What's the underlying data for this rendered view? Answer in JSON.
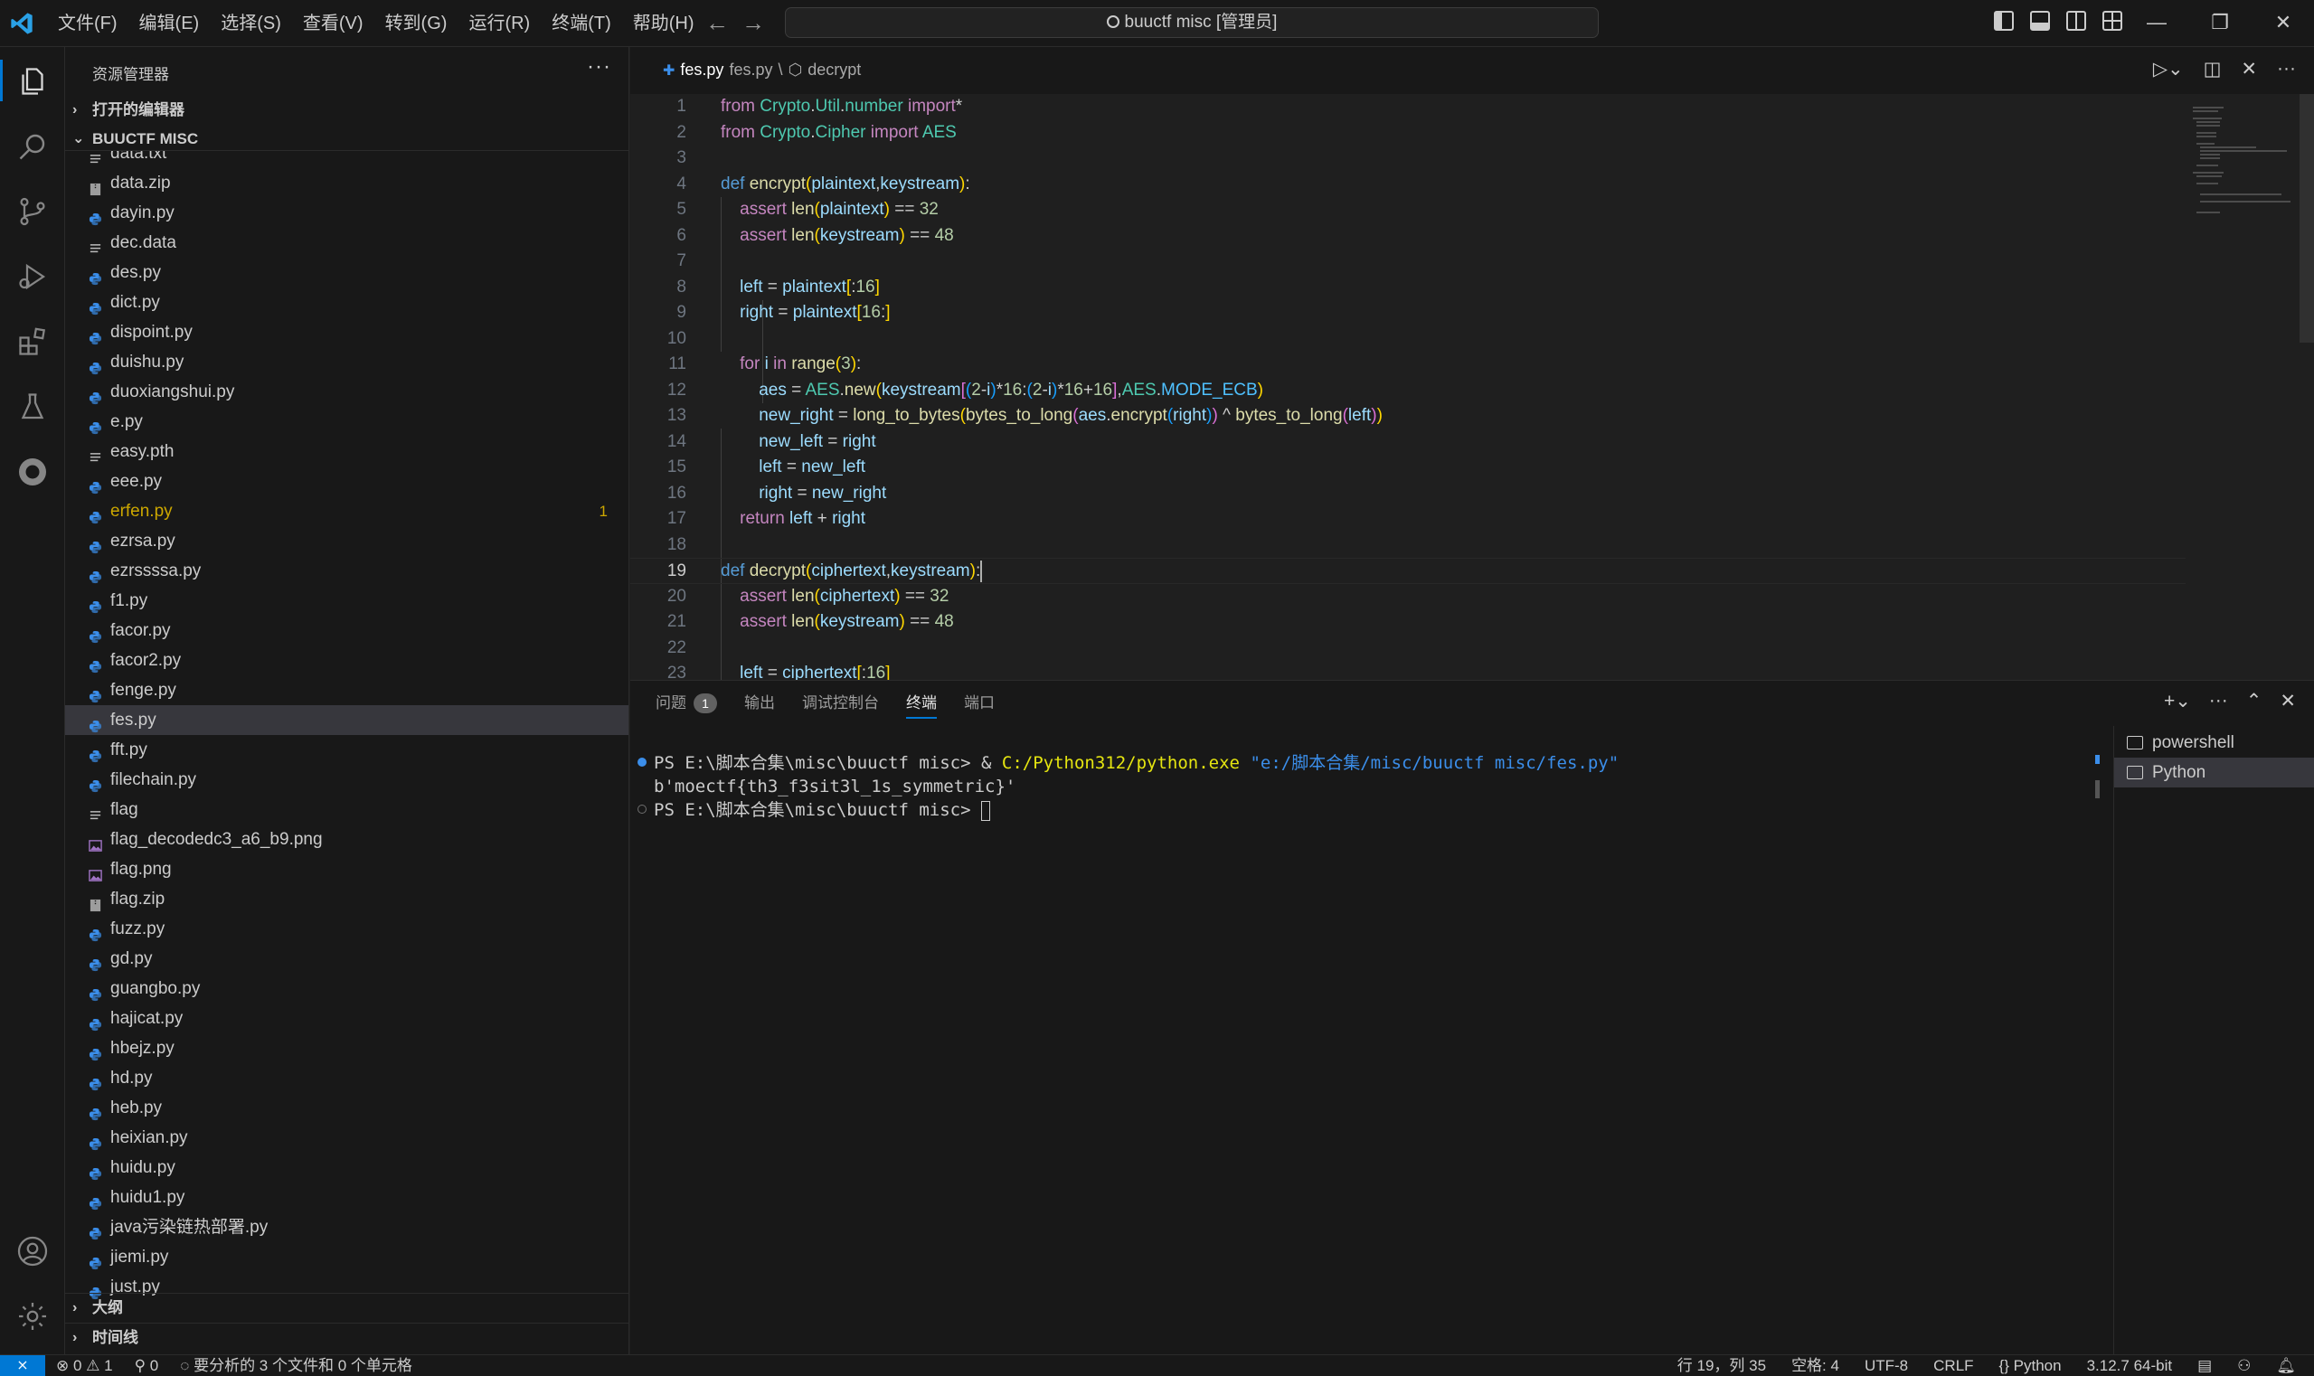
{
  "titlebar": {
    "menus": [
      "文件(F)",
      "编辑(E)",
      "选择(S)",
      "查看(V)",
      "转到(G)",
      "运行(R)",
      "终端(T)",
      "帮助(H)"
    ],
    "command_center": "buuctf misc [管理员]",
    "nav_back": "←",
    "nav_forward": "→",
    "win_minimize": "—",
    "win_restore": "❐",
    "win_close": "✕"
  },
  "sidebar": {
    "title": "资源管理器",
    "more": "···",
    "open_editors": "打开的编辑器",
    "folder": "BUUCTF MISC",
    "outline": "大纲",
    "timeline": "时间线",
    "files": [
      {
        "name": "data.txt",
        "type": "text"
      },
      {
        "name": "data.zip",
        "type": "zip"
      },
      {
        "name": "dayin.py",
        "type": "py"
      },
      {
        "name": "dec.data",
        "type": "text"
      },
      {
        "name": "des.py",
        "type": "py"
      },
      {
        "name": "dict.py",
        "type": "py"
      },
      {
        "name": "dispoint.py",
        "type": "py"
      },
      {
        "name": "duishu.py",
        "type": "py"
      },
      {
        "name": "duoxiangshui.py",
        "type": "py"
      },
      {
        "name": "e.py",
        "type": "py"
      },
      {
        "name": "easy.pth",
        "type": "text"
      },
      {
        "name": "eee.py",
        "type": "py"
      },
      {
        "name": "erfen.py",
        "type": "py",
        "badge": "1"
      },
      {
        "name": "ezrsa.py",
        "type": "py"
      },
      {
        "name": "ezrssssa.py",
        "type": "py"
      },
      {
        "name": "f1.py",
        "type": "py"
      },
      {
        "name": "facor.py",
        "type": "py"
      },
      {
        "name": "facor2.py",
        "type": "py"
      },
      {
        "name": "fenge.py",
        "type": "py"
      },
      {
        "name": "fes.py",
        "type": "py",
        "selected": true
      },
      {
        "name": "fft.py",
        "type": "py"
      },
      {
        "name": "filechain.py",
        "type": "py"
      },
      {
        "name": "flag",
        "type": "text"
      },
      {
        "name": "flag_decodedc3_a6_b9.png",
        "type": "img"
      },
      {
        "name": "flag.png",
        "type": "img"
      },
      {
        "name": "flag.zip",
        "type": "zip"
      },
      {
        "name": "fuzz.py",
        "type": "py"
      },
      {
        "name": "gd.py",
        "type": "py"
      },
      {
        "name": "guangbo.py",
        "type": "py"
      },
      {
        "name": "hajicat.py",
        "type": "py"
      },
      {
        "name": "hbejz.py",
        "type": "py"
      },
      {
        "name": "hd.py",
        "type": "py"
      },
      {
        "name": "heb.py",
        "type": "py"
      },
      {
        "name": "heixian.py",
        "type": "py"
      },
      {
        "name": "huidu.py",
        "type": "py"
      },
      {
        "name": "huidu1.py",
        "type": "py"
      },
      {
        "name": "java污染链热部署.py",
        "type": "py"
      },
      {
        "name": "jiemi.py",
        "type": "py"
      },
      {
        "name": "just.py",
        "type": "py"
      }
    ]
  },
  "editor": {
    "filename": "fes.py",
    "breadcrumb_path": "fes.py",
    "breadcrumb_symbol": "decrypt",
    "current_line": 19,
    "lines": [
      "1",
      "2",
      "3",
      "4",
      "5",
      "6",
      "7",
      "8",
      "9",
      "10",
      "11",
      "12",
      "13",
      "14",
      "15",
      "16",
      "17",
      "18",
      "19",
      "20",
      "21",
      "22",
      "23"
    ]
  },
  "panel": {
    "tabs": [
      "问题",
      "输出",
      "调试控制台",
      "终端",
      "端口"
    ],
    "problems_count": "1",
    "terminal_prompt1": "PS E:\\脚本合集\\misc\\buuctf misc> ",
    "terminal_cmd_amp": "& ",
    "terminal_cmd_exe": "C:/Python312/python.exe",
    "terminal_cmd_arg": "\"e:/脚本合集/misc/buuctf misc/fes.py\"",
    "terminal_output": "b'moectf{th3_f3sit3l_1s_symmetric}'",
    "terminal_prompt2": "PS E:\\脚本合集\\misc\\buuctf misc> ",
    "terminals": [
      "powershell",
      "Python"
    ]
  },
  "statusbar": {
    "remote": "⨯",
    "errors": "0",
    "warnings": "1",
    "ports": "0",
    "analyzing": "要分析的 3 个文件和 0 个单元格",
    "position": "行 19，列 35",
    "spaces": "空格: 4",
    "encoding": "UTF-8",
    "eol": "CRLF",
    "language": "Python",
    "interpreter": "3.12.7 64-bit"
  },
  "colors": {
    "accent": "#0078d4",
    "warning": "#cca700"
  }
}
